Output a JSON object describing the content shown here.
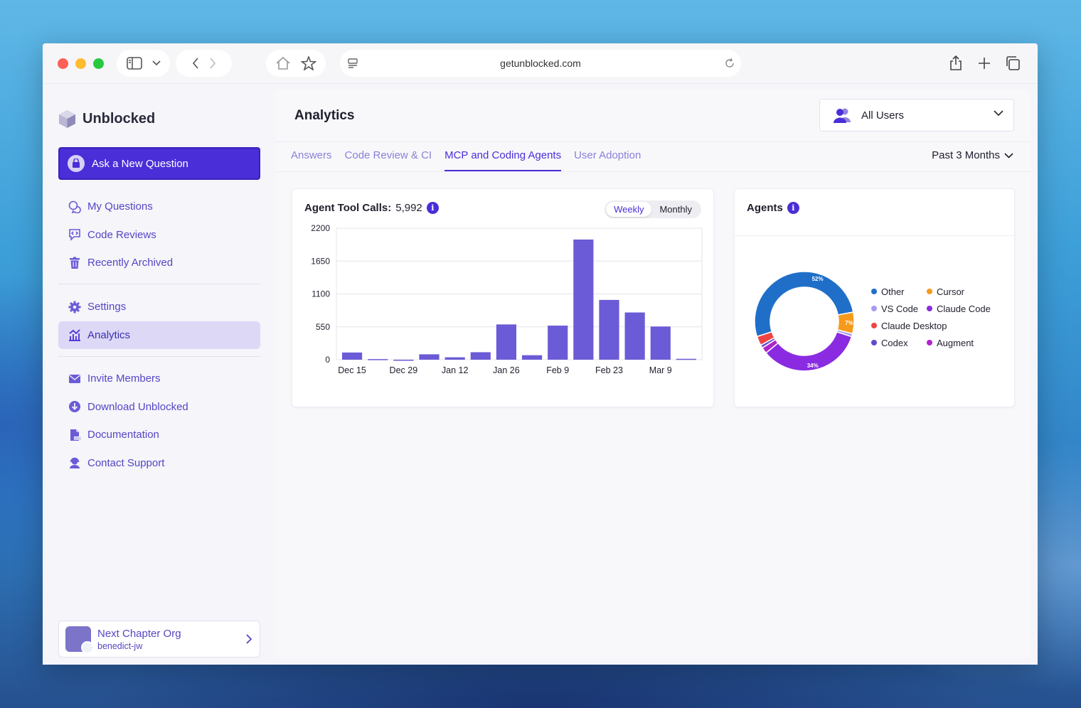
{
  "browser": {
    "url": "getunblocked.com"
  },
  "brand": {
    "name": "Unblocked"
  },
  "sidebar": {
    "ask_button": "Ask a New Question",
    "group1": [
      {
        "label": "My Questions",
        "icon": "chat-bubbles-icon"
      },
      {
        "label": "Code Reviews",
        "icon": "code-review-icon"
      },
      {
        "label": "Recently Archived",
        "icon": "trash-icon"
      }
    ],
    "group2": [
      {
        "label": "Settings",
        "icon": "gear-icon"
      },
      {
        "label": "Analytics",
        "icon": "analytics-icon",
        "active": true
      }
    ],
    "group3": [
      {
        "label": "Invite Members",
        "icon": "mail-icon"
      },
      {
        "label": "Download Unblocked",
        "icon": "download-icon"
      },
      {
        "label": "Documentation",
        "icon": "document-icon"
      },
      {
        "label": "Contact Support",
        "icon": "support-icon"
      }
    ],
    "org": {
      "name": "Next Chapter Org",
      "user": "benedict-jw"
    }
  },
  "main": {
    "title": "Analytics",
    "user_filter": "All Users",
    "tabs": [
      {
        "label": "Answers"
      },
      {
        "label": "Code Review & CI"
      },
      {
        "label": "MCP and Coding Agents",
        "active": true
      },
      {
        "label": "User Adoption"
      }
    ],
    "range": "Past 3 Months"
  },
  "tool_calls_card": {
    "title": "Agent Tool Calls:",
    "total": "5,992",
    "toggle": {
      "weekly": "Weekly",
      "monthly": "Monthly",
      "selected": "Weekly"
    }
  },
  "agents_card": {
    "title": "Agents",
    "legend": [
      {
        "label": "Other",
        "color": "#1f6fc9"
      },
      {
        "label": "Cursor",
        "color": "#f59a1b"
      },
      {
        "label": "VS Code",
        "color": "#a89bf0"
      },
      {
        "label": "Claude Code",
        "color": "#8a2be2"
      },
      {
        "label": "Claude Desktop",
        "color": "#ef4444"
      },
      {
        "label": "Codex",
        "color": "#5b4ccf"
      },
      {
        "label": "Augment",
        "color": "#b025c8"
      }
    ]
  },
  "chart_data": [
    {
      "type": "bar",
      "title": "Agent Tool Calls: 5,992",
      "xlabel": "",
      "ylabel": "",
      "ylim": [
        0,
        2200
      ],
      "yticks": [
        0,
        550,
        1100,
        1650,
        2200
      ],
      "x_tick_labels": [
        "Dec 15",
        "Dec 29",
        "Jan 12",
        "Jan 26",
        "Feb 9",
        "Feb 23",
        "Mar 9"
      ],
      "categories": [
        "Dec 15",
        "Dec 22",
        "Dec 29",
        "Jan 5",
        "Jan 12",
        "Jan 19",
        "Jan 26",
        "Feb 2",
        "Feb 9",
        "Feb 16",
        "Feb 23",
        "Mar 2",
        "Mar 9",
        "Mar 16"
      ],
      "values": [
        120,
        10,
        0,
        90,
        40,
        125,
        590,
        75,
        570,
        2010,
        1000,
        790,
        555,
        15
      ],
      "color": "#6b5bd6",
      "grid": true
    },
    {
      "type": "pie",
      "title": "Agents",
      "donut": true,
      "labels": [
        "Other",
        "Cursor",
        "VS Code",
        "Claude Code",
        "Claude Desktop",
        "Codex",
        "Augment"
      ],
      "values": [
        52,
        7,
        1,
        34,
        3,
        1,
        2
      ],
      "data_labels": [
        "52%",
        "7%",
        "34%"
      ],
      "colors": [
        "#1f6fc9",
        "#f59a1b",
        "#a89bf0",
        "#8a2be2",
        "#ef4444",
        "#5b4ccf",
        "#b025c8"
      ]
    }
  ]
}
